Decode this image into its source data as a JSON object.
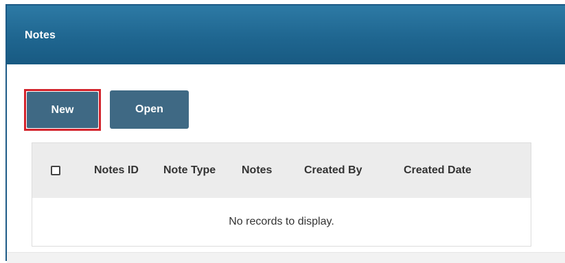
{
  "panel": {
    "title": "Notes"
  },
  "toolbar": {
    "new_label": "New",
    "open_label": "Open"
  },
  "grid": {
    "columns": [
      "Notes ID",
      "Note Type",
      "Notes",
      "Created By",
      "Created Date"
    ],
    "empty_message": "No records to display.",
    "select_all_checked": false
  },
  "colors": {
    "header": "#1f6690",
    "button": "#3f6984",
    "highlight": "#d3232b"
  }
}
